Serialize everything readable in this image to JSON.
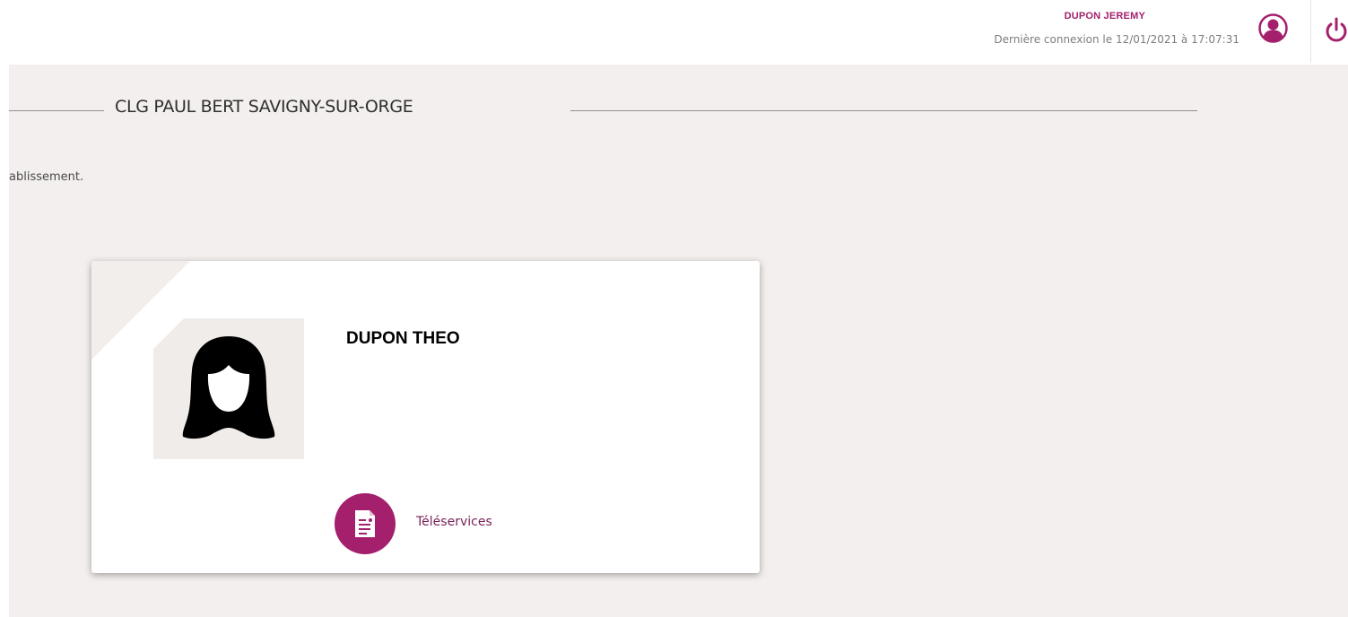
{
  "header": {
    "user_name": "DUPON JEREMY",
    "last_login": "Dernière connexion le 12/01/2021 à 17:07:31",
    "icons": {
      "profile": "user-circle-icon",
      "logout": "power-icon"
    }
  },
  "school": {
    "title": "CLG PAUL BERT SAVIGNY-SUR-ORGE",
    "intro_text": "ablissement."
  },
  "student_card": {
    "name": "DUPON THEO",
    "avatar": "person-silhouette-icon",
    "action_label": "Téléservices",
    "action_icon": "document-icon"
  },
  "colors": {
    "accent": "#a4206c",
    "background": "#f3efee",
    "card": "#ffffff"
  }
}
